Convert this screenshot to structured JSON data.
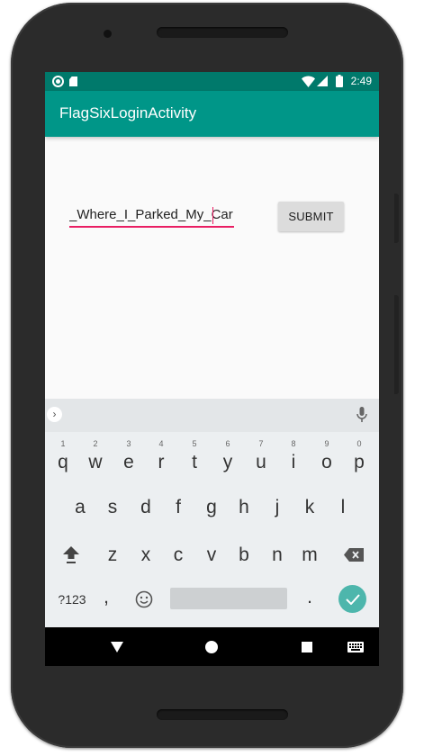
{
  "status_bar": {
    "time": "2:49"
  },
  "app_bar": {
    "title": "FlagSixLoginActivity"
  },
  "form": {
    "input_value": "_Where_I_Parked_My_Car",
    "submit_label": "SUBMIT"
  },
  "colors": {
    "status_bar": "#00796b",
    "app_bar": "#009688",
    "accent": "#e91e63",
    "enter_key": "#4db6ac"
  },
  "keyboard": {
    "row1": [
      {
        "letter": "q",
        "hint": "1"
      },
      {
        "letter": "w",
        "hint": "2"
      },
      {
        "letter": "e",
        "hint": "3"
      },
      {
        "letter": "r",
        "hint": "4"
      },
      {
        "letter": "t",
        "hint": "5"
      },
      {
        "letter": "y",
        "hint": "6"
      },
      {
        "letter": "u",
        "hint": "7"
      },
      {
        "letter": "i",
        "hint": "8"
      },
      {
        "letter": "o",
        "hint": "9"
      },
      {
        "letter": "p",
        "hint": "0"
      }
    ],
    "row2": [
      "a",
      "s",
      "d",
      "f",
      "g",
      "h",
      "j",
      "k",
      "l"
    ],
    "row3": [
      "z",
      "x",
      "c",
      "v",
      "b",
      "n",
      "m"
    ],
    "symbols_label": "?123",
    "comma": ",",
    "period": "."
  },
  "icons": [
    "camera-icon",
    "sd-card-icon",
    "wifi-icon",
    "signal-icon",
    "battery-icon",
    "chevron-right-icon",
    "mic-icon",
    "shift-icon",
    "backspace-icon",
    "emoji-icon",
    "check-icon",
    "back-icon",
    "home-icon",
    "recents-icon",
    "keyboard-icon"
  ]
}
